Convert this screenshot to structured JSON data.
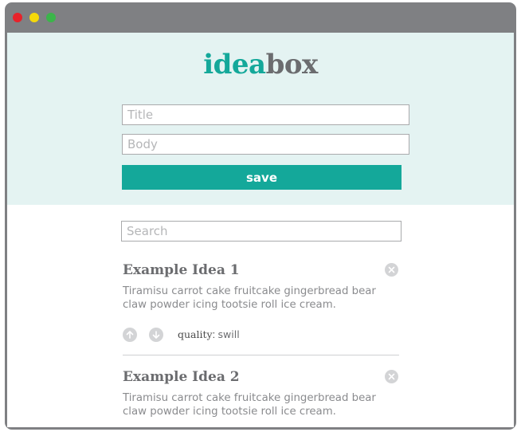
{
  "window": {
    "controls": [
      "close",
      "minimize",
      "maximize"
    ],
    "control_colors": {
      "close": "#e8222a",
      "minimize": "#f5d90a",
      "maximize": "#3bb54a"
    }
  },
  "logo": {
    "part1": "idea",
    "part2": "box"
  },
  "colors": {
    "accent": "#14a89a",
    "header_bg": "#e4f3f2",
    "frame": "#7f8083"
  },
  "form": {
    "title_placeholder": "Title",
    "body_placeholder": "Body",
    "save_label": "save"
  },
  "search": {
    "placeholder": "Search"
  },
  "ideas": [
    {
      "title": "Example Idea 1",
      "body": "Tiramisu carrot cake fruitcake gingerbread bear claw powder icing tootsie roll ice cream.",
      "quality_label": "quality",
      "quality_value": "swill"
    },
    {
      "title": "Example Idea 2",
      "body": "Tiramisu carrot cake fruitcake gingerbread bear claw powder icing tootsie roll ice cream."
    }
  ]
}
